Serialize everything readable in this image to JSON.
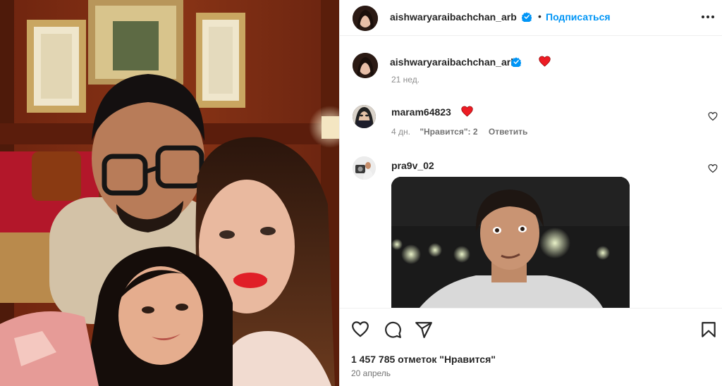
{
  "header": {
    "username": "aishwaryaraibachchan_arb",
    "separator": "•",
    "follow_label": "Подписаться",
    "more_icon": "more-horizontal-icon"
  },
  "caption": {
    "username": "aishwaryaraibachchan_arb",
    "emoji": "red-heart",
    "time": "21 нед."
  },
  "comments": [
    {
      "username": "maram64823",
      "emoji": "red-heart",
      "time": "4 дн.",
      "likes": "\"Нравится\": 2",
      "reply_label": "Ответить"
    },
    {
      "username": "pra9v_02",
      "attachment": "gif"
    }
  ],
  "footer": {
    "likes": "1 457 785 отметок \"Нравится\"",
    "date": "20 апрель"
  },
  "colors": {
    "accent": "#0095f6",
    "verified": "#0095f6",
    "heart": "#ed1c24",
    "text": "#262626",
    "muted": "#8e8e8e"
  }
}
